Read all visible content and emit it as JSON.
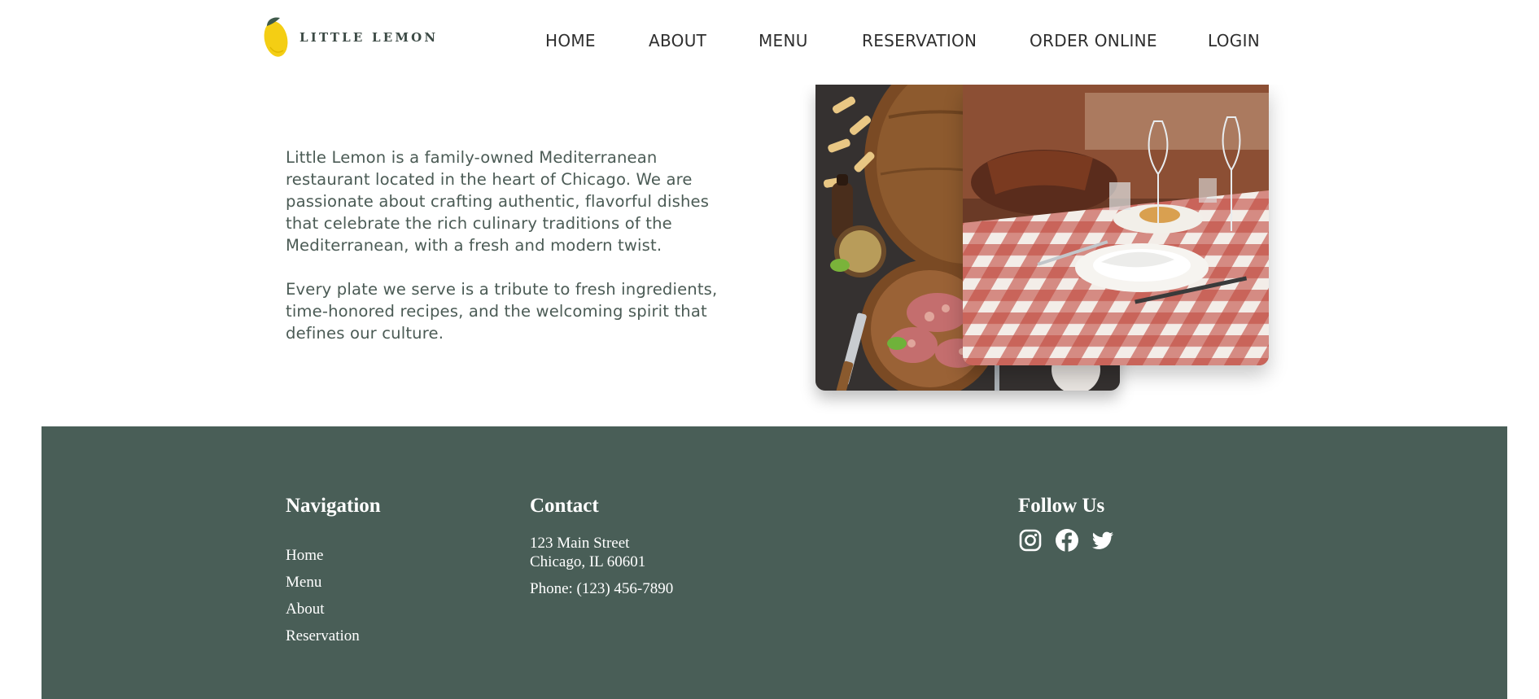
{
  "header": {
    "logo_text": "LITTLE LEMON",
    "logo_icon": "lemon-icon",
    "nav": [
      {
        "label": "HOME"
      },
      {
        "label": "ABOUT"
      },
      {
        "label": "MENU"
      },
      {
        "label": "RESERVATION"
      },
      {
        "label": "ORDER ONLINE"
      },
      {
        "label": "LOGIN"
      }
    ]
  },
  "about": {
    "paragraph1": "Little Lemon is a family-owned Mediterranean restaurant located in the heart of Chicago. We are passionate about crafting authentic, flavorful dishes that celebrate the rich culinary traditions of the Mediterranean, with a fresh and modern twist.",
    "paragraph2": "Every plate we serve is a tribute to fresh ingredients, time-honored recipes, and the welcoming spirit that defines our culture."
  },
  "footer": {
    "navigation": {
      "heading": "Navigation",
      "links": [
        {
          "label": "Home"
        },
        {
          "label": "Menu"
        },
        {
          "label": "About"
        },
        {
          "label": "Reservation"
        }
      ]
    },
    "contact": {
      "heading": "Contact",
      "address_line1": "123 Main Street",
      "address_line2": "Chicago, IL 60601",
      "phone": "Phone: (123) 456-7890"
    },
    "follow": {
      "heading": "Follow Us",
      "icons": [
        "instagram-icon",
        "facebook-icon",
        "twitter-icon"
      ]
    }
  },
  "colors": {
    "primary_green": "#495e57",
    "lemon_yellow": "#f4ce14",
    "text_gray": "#4b5b55",
    "white": "#ffffff"
  }
}
